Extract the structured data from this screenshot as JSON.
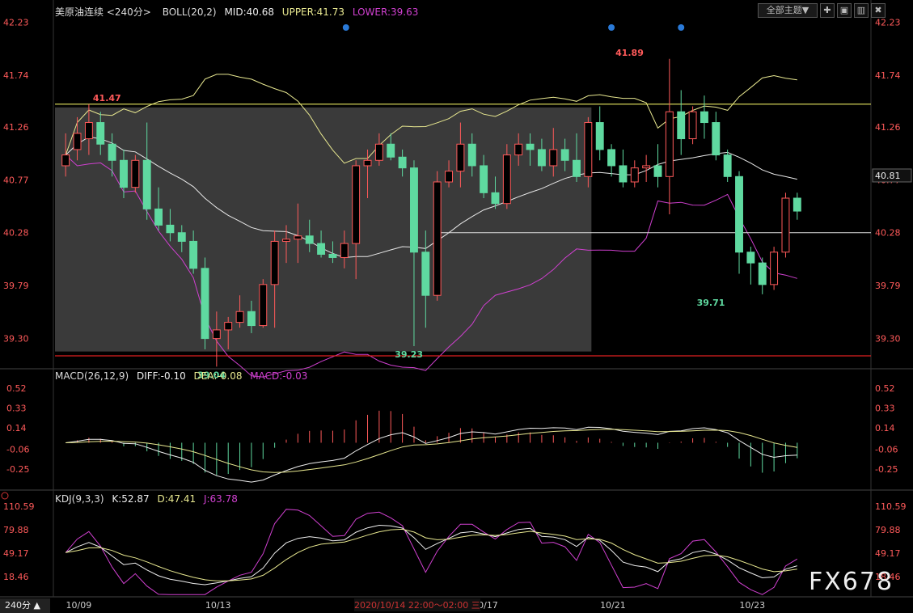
{
  "symbol": "美原油连续",
  "period_label": "<240分>",
  "indicators": {
    "boll": {
      "label": "BOLL(20,2)",
      "mid": "MID:40.68",
      "upper": "UPPER:41.73",
      "lower": "LOWER:39.63"
    },
    "macd": {
      "label": "MACD(26,12,9)",
      "diff": "DIFF:-0.10",
      "dea": "DEA:-0.08",
      "macd": "MACD:-0.03"
    },
    "kdj": {
      "label": "KDJ(9,3,3)",
      "k": "K:52.87",
      "d": "D:47.41",
      "j": "J:63.78"
    }
  },
  "toolbar": {
    "theme_label": "全部主题▼",
    "icons": [
      "✚",
      "▣",
      "▥",
      "✖"
    ]
  },
  "period_button": "240分 ▲",
  "watermark": "FX678",
  "crosshair_label": "2020/10/14 22:00～02:00 三",
  "colors": {
    "up": "#ff5a5a",
    "down": "#5fd9a0",
    "upper": "#e8e890",
    "mid": "#e8e8e8",
    "lower": "#d040d0",
    "hline_yellow": "#e8e860",
    "hline_red": "#e02020",
    "axis_text": "#ff5a5a"
  },
  "chart_data": {
    "type": "candlestick",
    "price_axis": {
      "ticks": [
        42.23,
        41.74,
        41.26,
        40.77,
        40.28,
        39.79,
        39.3
      ],
      "ylim": [
        39.05,
        42.3
      ]
    },
    "macd_axis": {
      "ticks": [
        "0.52",
        "0.33",
        "0.14",
        "-0.06",
        "-0.25"
      ],
      "ylim": [
        -0.45,
        0.58
      ]
    },
    "kdj_axis": {
      "ticks": [
        "110.59",
        "79.88",
        "49.17",
        "18.46"
      ],
      "ylim": [
        -8,
        115
      ]
    },
    "x_dates": [
      {
        "label": "10/09",
        "index": 1
      },
      {
        "label": "10/13",
        "index": 13
      },
      {
        "label": "10/17",
        "index": 36
      },
      {
        "label": "10/21",
        "index": 47
      },
      {
        "label": "10/23",
        "index": 59
      }
    ],
    "annotations": [
      {
        "text": "41.47",
        "index": 2,
        "value": 41.47
      },
      {
        "text": "39.04",
        "index": 11,
        "value": 39.04
      },
      {
        "text": "39.23",
        "index": 28,
        "value": 39.23
      },
      {
        "text": "41.89",
        "index": 47,
        "value": 41.89
      },
      {
        "text": "39.71",
        "index": 54,
        "value": 39.71
      }
    ],
    "current_price": "40.81",
    "last_index_label": "40.28",
    "hlines": [
      {
        "value": 41.47,
        "color": "yellow"
      },
      {
        "value": 39.14,
        "color": "red"
      }
    ],
    "candles": [
      {
        "o": 40.9,
        "h": 41.2,
        "l": 40.8,
        "c": 41.0
      },
      {
        "o": 41.05,
        "h": 41.35,
        "l": 40.95,
        "c": 41.2
      },
      {
        "o": 41.15,
        "h": 41.47,
        "l": 41.0,
        "c": 41.3
      },
      {
        "o": 41.3,
        "h": 41.4,
        "l": 41.0,
        "c": 41.1
      },
      {
        "o": 41.1,
        "h": 41.2,
        "l": 40.8,
        "c": 40.95
      },
      {
        "o": 40.95,
        "h": 41.05,
        "l": 40.6,
        "c": 40.7
      },
      {
        "o": 40.7,
        "h": 41.0,
        "l": 40.65,
        "c": 40.95
      },
      {
        "o": 40.95,
        "h": 41.3,
        "l": 40.4,
        "c": 40.5
      },
      {
        "o": 40.5,
        "h": 40.7,
        "l": 40.3,
        "c": 40.35
      },
      {
        "o": 40.35,
        "h": 40.5,
        "l": 40.2,
        "c": 40.28
      },
      {
        "o": 40.28,
        "h": 40.35,
        "l": 40.1,
        "c": 40.2
      },
      {
        "o": 40.2,
        "h": 40.3,
        "l": 39.9,
        "c": 39.95
      },
      {
        "o": 39.95,
        "h": 40.05,
        "l": 39.2,
        "c": 39.3
      },
      {
        "o": 39.3,
        "h": 39.55,
        "l": 39.04,
        "c": 39.38
      },
      {
        "o": 39.38,
        "h": 39.5,
        "l": 39.2,
        "c": 39.45
      },
      {
        "o": 39.45,
        "h": 39.7,
        "l": 39.4,
        "c": 39.55
      },
      {
        "o": 39.55,
        "h": 39.65,
        "l": 39.35,
        "c": 39.42
      },
      {
        "o": 39.42,
        "h": 39.85,
        "l": 39.4,
        "c": 39.8
      },
      {
        "o": 39.8,
        "h": 40.3,
        "l": 39.4,
        "c": 40.2
      },
      {
        "o": 40.2,
        "h": 40.35,
        "l": 40.0,
        "c": 40.22
      },
      {
        "o": 40.22,
        "h": 40.55,
        "l": 40.0,
        "c": 40.25
      },
      {
        "o": 40.25,
        "h": 40.4,
        "l": 40.1,
        "c": 40.18
      },
      {
        "o": 40.18,
        "h": 40.3,
        "l": 40.05,
        "c": 40.08
      },
      {
        "o": 40.08,
        "h": 40.2,
        "l": 40.0,
        "c": 40.05
      },
      {
        "o": 40.05,
        "h": 40.3,
        "l": 39.95,
        "c": 40.18
      },
      {
        "o": 40.18,
        "h": 40.95,
        "l": 39.85,
        "c": 40.9
      },
      {
        "o": 40.9,
        "h": 41.05,
        "l": 40.6,
        "c": 40.95
      },
      {
        "o": 40.95,
        "h": 41.2,
        "l": 40.9,
        "c": 41.1
      },
      {
        "o": 41.1,
        "h": 41.2,
        "l": 40.95,
        "c": 40.98
      },
      {
        "o": 40.98,
        "h": 41.05,
        "l": 40.8,
        "c": 40.88
      },
      {
        "o": 40.88,
        "h": 40.95,
        "l": 39.23,
        "c": 40.1
      },
      {
        "o": 40.1,
        "h": 40.3,
        "l": 39.4,
        "c": 39.7
      },
      {
        "o": 39.7,
        "h": 40.85,
        "l": 39.65,
        "c": 40.75
      },
      {
        "o": 40.75,
        "h": 40.95,
        "l": 40.7,
        "c": 40.85
      },
      {
        "o": 40.85,
        "h": 41.3,
        "l": 40.7,
        "c": 41.1
      },
      {
        "o": 41.1,
        "h": 41.2,
        "l": 40.8,
        "c": 40.9
      },
      {
        "o": 40.9,
        "h": 41.0,
        "l": 40.6,
        "c": 40.65
      },
      {
        "o": 40.65,
        "h": 40.8,
        "l": 40.5,
        "c": 40.55
      },
      {
        "o": 40.55,
        "h": 41.1,
        "l": 40.5,
        "c": 41.0
      },
      {
        "o": 41.0,
        "h": 41.2,
        "l": 40.9,
        "c": 41.1
      },
      {
        "o": 41.1,
        "h": 41.2,
        "l": 40.9,
        "c": 41.05
      },
      {
        "o": 41.05,
        "h": 41.15,
        "l": 40.85,
        "c": 40.9
      },
      {
        "o": 40.9,
        "h": 41.25,
        "l": 40.8,
        "c": 41.05
      },
      {
        "o": 41.05,
        "h": 41.15,
        "l": 40.85,
        "c": 40.95
      },
      {
        "o": 40.95,
        "h": 41.2,
        "l": 40.75,
        "c": 40.8
      },
      {
        "o": 40.8,
        "h": 41.35,
        "l": 40.7,
        "c": 41.3
      },
      {
        "o": 41.3,
        "h": 41.45,
        "l": 40.95,
        "c": 41.05
      },
      {
        "o": 41.05,
        "h": 41.1,
        "l": 40.8,
        "c": 40.9
      },
      {
        "o": 40.9,
        "h": 41.05,
        "l": 40.7,
        "c": 40.75
      },
      {
        "o": 40.75,
        "h": 40.95,
        "l": 40.7,
        "c": 40.88
      },
      {
        "o": 40.88,
        "h": 41.0,
        "l": 40.75,
        "c": 40.9
      },
      {
        "o": 40.9,
        "h": 41.1,
        "l": 40.7,
        "c": 40.8
      },
      {
        "o": 40.8,
        "h": 41.89,
        "l": 40.45,
        "c": 41.4
      },
      {
        "o": 41.4,
        "h": 41.6,
        "l": 41.0,
        "c": 41.15
      },
      {
        "o": 41.15,
        "h": 41.45,
        "l": 41.1,
        "c": 41.4
      },
      {
        "o": 41.4,
        "h": 41.55,
        "l": 41.15,
        "c": 41.3
      },
      {
        "o": 41.3,
        "h": 41.4,
        "l": 40.95,
        "c": 41.0
      },
      {
        "o": 41.0,
        "h": 41.05,
        "l": 40.75,
        "c": 40.8
      },
      {
        "o": 40.8,
        "h": 40.85,
        "l": 39.9,
        "c": 40.1
      },
      {
        "o": 40.1,
        "h": 40.15,
        "l": 39.8,
        "c": 40.0
      },
      {
        "o": 40.0,
        "h": 40.05,
        "l": 39.71,
        "c": 39.8
      },
      {
        "o": 39.8,
        "h": 40.15,
        "l": 39.75,
        "c": 40.1
      },
      {
        "o": 40.1,
        "h": 40.65,
        "l": 40.05,
        "c": 40.6
      },
      {
        "o": 40.6,
        "h": 40.65,
        "l": 40.4,
        "c": 40.48
      }
    ]
  }
}
